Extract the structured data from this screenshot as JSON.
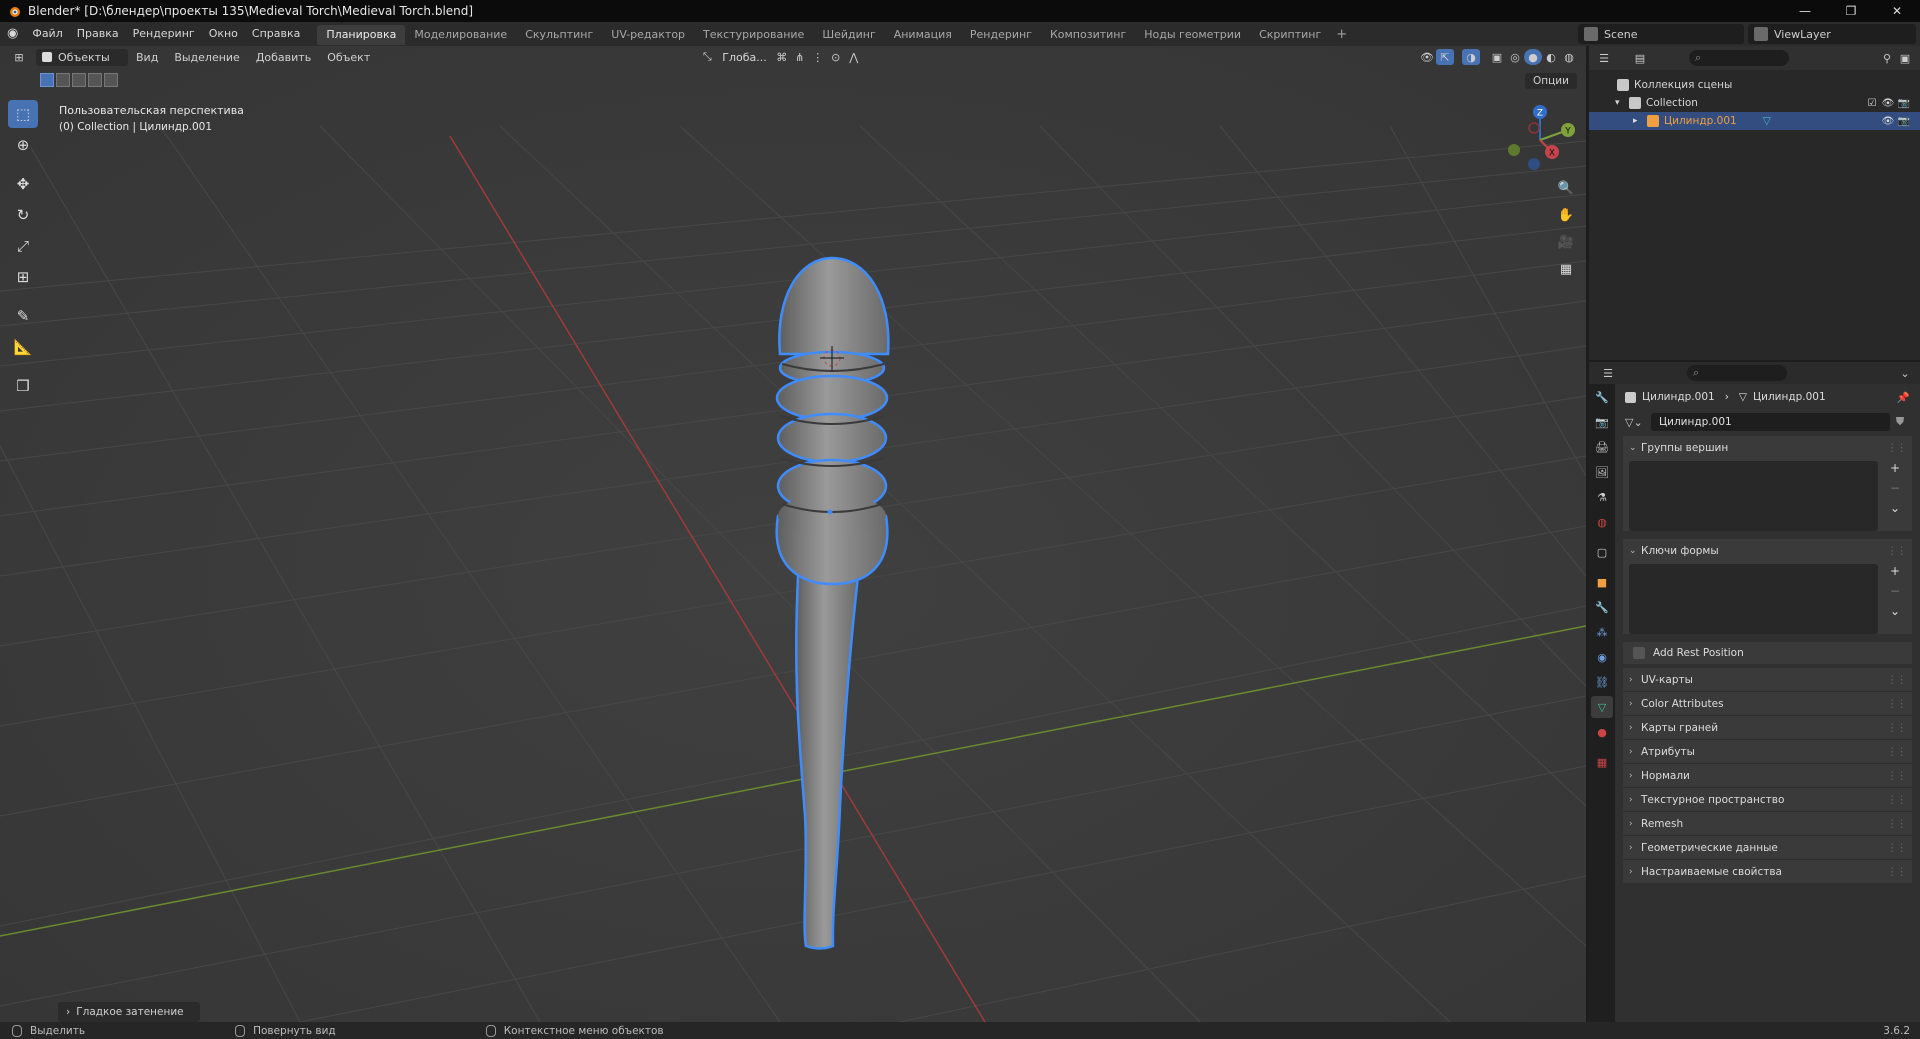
{
  "window": {
    "title": "Blender* [D:\\блендер\\проекты 135\\Medieval Torch\\Medieval Torch.blend]",
    "controls": [
      "—",
      "❐",
      "✕"
    ]
  },
  "menu": {
    "items": [
      "Файл",
      "Правка",
      "Рендеринг",
      "Окно",
      "Справка"
    ]
  },
  "workspaces": {
    "tabs": [
      "Планировка",
      "Моделирование",
      "Скульптинг",
      "UV-редактор",
      "Текстурирование",
      "Шейдинг",
      "Анимация",
      "Рендеринг",
      "Композитинг",
      "Ноды геометрии",
      "Скриптинг"
    ],
    "active_index": 0,
    "add": "+"
  },
  "scene": {
    "name": "Scene",
    "view_layer": "ViewLayer"
  },
  "viewport": {
    "mode": "Объекты",
    "menus": [
      "Вид",
      "Выделение",
      "Добавить",
      "Объект"
    ],
    "transform_orientation": "Глоба...",
    "options": "Опции",
    "info_line1": "Пользовательская перспектива",
    "info_line2": "(0) Collection | Цилиндр.001",
    "last_operator": "Гладкое затенение",
    "gizmo": {
      "x": "X",
      "y": "Y",
      "z": "Z"
    }
  },
  "outliner": {
    "search_placeholder": "",
    "root": "Коллекция сцены",
    "collection": "Collection",
    "object": "Цилиндр.001"
  },
  "properties": {
    "breadcrumb_object": "Цилиндр.001",
    "breadcrumb_data": "Цилиндр.001",
    "mesh_name": "Цилиндр.001",
    "panels": {
      "vertex_groups": "Группы вершин",
      "shape_keys": "Ключи формы",
      "add_rest_position": "Add Rest Position",
      "uv_maps": "UV-карты",
      "color_attributes": "Color Attributes",
      "face_maps": "Карты граней",
      "attributes": "Атрибуты",
      "normals": "Нормали",
      "texture_space": "Текстурное пространство",
      "remesh": "Remesh",
      "geometry_data": "Геометрические данные",
      "custom_props": "Настраиваемые свойства"
    }
  },
  "statusbar": {
    "select": "Выделить",
    "rotate_view": "Повернуть вид",
    "context_menu": "Контекстное меню объектов",
    "version": "3.6.2"
  },
  "colors": {
    "accent": "#4772b3",
    "selected_outline": "#3f8cff",
    "x_axis": "#c4444d",
    "y_axis": "#7ea33a",
    "object_orange": "#f0a040"
  }
}
